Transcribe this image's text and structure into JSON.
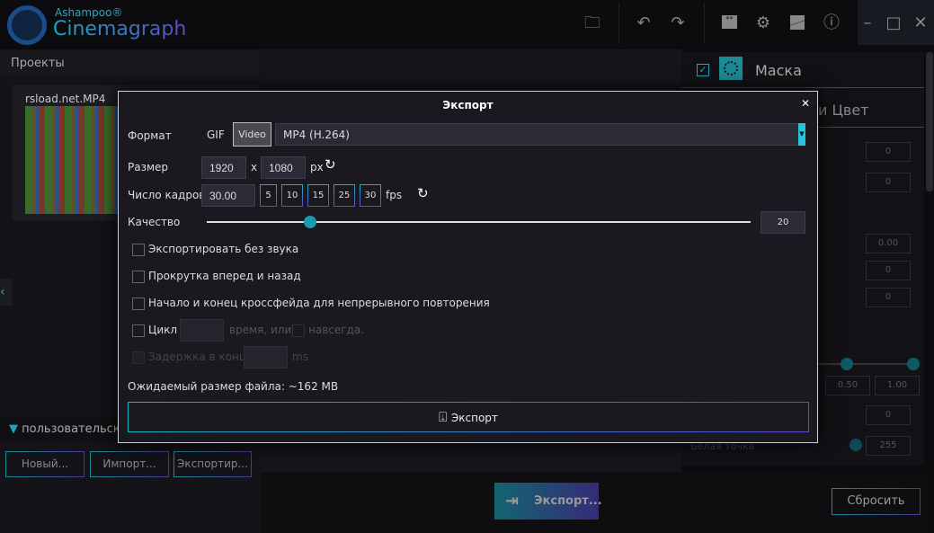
{
  "app": {
    "brand_top": "Ashampoo®",
    "brand_name": "Cinemagraph"
  },
  "toolbar": {
    "icons": [
      "folder-icon",
      "undo-icon",
      "redo-icon",
      "feedback-icon",
      "settings-icon",
      "theme-icon",
      "info-icon"
    ]
  },
  "left": {
    "projects_header": "Проекты",
    "project_name": "rsload.net.MP4",
    "preset": "пользовательск",
    "buttons": [
      "Новый...",
      "Импорт...",
      "Экспортир..."
    ]
  },
  "right": {
    "mask_label": "Маска",
    "color_tab": "и Цвет",
    "values": [
      "0",
      "0",
      "0.00",
      "0",
      "0",
      "0.50",
      "1.00",
      "0",
      "255"
    ],
    "white_point": "Белая точка"
  },
  "bottom": {
    "export_button": "Экспорт...",
    "reset_button": "Сбросить"
  },
  "dialog": {
    "title": "Экспорт",
    "format_label": "Формат",
    "gif": "GIF",
    "video": "Video",
    "codec": "MP4 (H.264)",
    "size_label": "Размер",
    "width": "1920",
    "x": "x",
    "height": "1080",
    "px": "px",
    "fps_label": "Число кадров",
    "fps_value": "30.00",
    "fps_presets": [
      "5",
      "10",
      "15",
      "25",
      "30"
    ],
    "fps_unit": "fps",
    "quality_label": "Качество",
    "quality_value": "20",
    "quality_fraction": 0.19,
    "options": [
      "Экспортировать без звука",
      "Прокрутка вперед и назад",
      "Начало и конец кроссфейда для непрерывного повторения"
    ],
    "loop_label": "Цикл",
    "loop_times": "время, или",
    "forever": "навсегда.",
    "delay_label": "Задержка в конце",
    "delay_unit": "ms",
    "filesize": "Ожидаемый размер файла:  ~162 MB",
    "export_button": "Экспорт"
  }
}
